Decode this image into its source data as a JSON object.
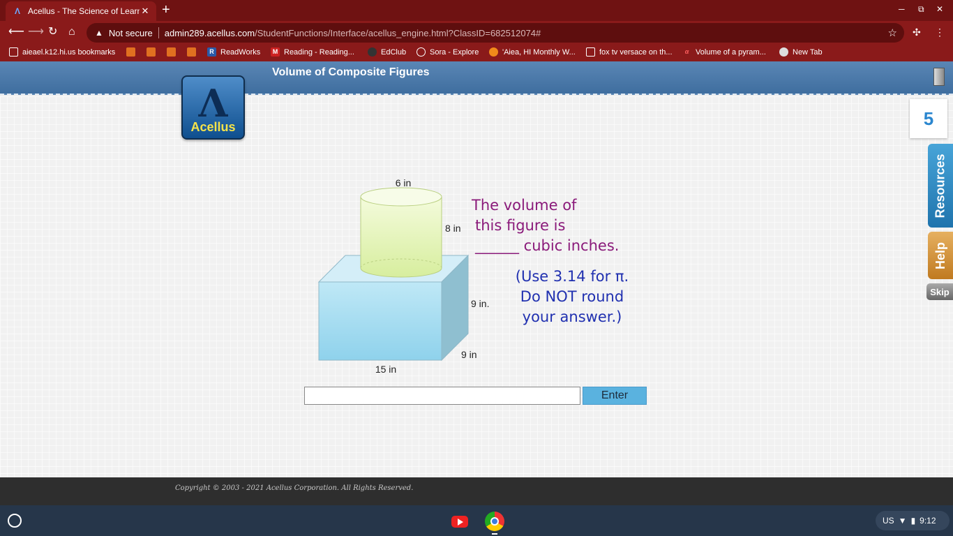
{
  "browser": {
    "tab_title": "Acellus - The Science of Learning",
    "tab_close": "✕",
    "new_tab": "+",
    "security_label": "Not secure",
    "url_host": "admin289.acellus.com",
    "url_path": "/StudentFunctions/Interface/acellus_engine.html?ClassID=682512074#"
  },
  "bookmarks": [
    {
      "label": "aieael.k12.hi.us bookmarks",
      "icon": "folder-icon"
    },
    {
      "label": "",
      "icon": "bookmark-icon"
    },
    {
      "label": "",
      "icon": "bookmark-icon"
    },
    {
      "label": "",
      "icon": "bookmark-icon"
    },
    {
      "label": "",
      "icon": "bookmark-icon"
    },
    {
      "label": "ReadWorks",
      "icon": "readworks-icon"
    },
    {
      "label": "Reading - Reading...",
      "icon": "mcgraw-icon"
    },
    {
      "label": "EdClub",
      "icon": "edclub-icon"
    },
    {
      "label": "Sora - Explore",
      "icon": "sora-icon"
    },
    {
      "label": "'Aiea, HI Monthly W...",
      "icon": "weather-icon"
    },
    {
      "label": "fox tv versace on th...",
      "icon": "doc-icon"
    },
    {
      "label": "Volume of a pyram...",
      "icon": "alpha-icon"
    },
    {
      "label": "New Tab",
      "icon": "globe-icon"
    }
  ],
  "app": {
    "lesson_title": "Volume of Composite Figures",
    "logo_text": "Acellus",
    "counter": "5",
    "resources_label": "Resources",
    "help_label": "Help",
    "skip_label": "Skip"
  },
  "problem": {
    "dims": {
      "cyl_diameter": "6 in",
      "cyl_height": "8 in",
      "box_height": "9 in.",
      "box_depth": "9 in",
      "box_length": "15 in"
    },
    "line1": "The volume of",
    "line2": "this figure is",
    "line3": "______ cubic inches.",
    "note1": "(Use 3.14 for π.",
    "note2": "Do NOT round",
    "note3": "your answer.)"
  },
  "answer": {
    "value": "",
    "enter_label": "Enter"
  },
  "footer": {
    "copyright": "Copyright © 2003 - 2021 Acellus Corporation.  All Rights Reserved."
  },
  "shelf": {
    "locale": "US",
    "time": "9:12"
  }
}
